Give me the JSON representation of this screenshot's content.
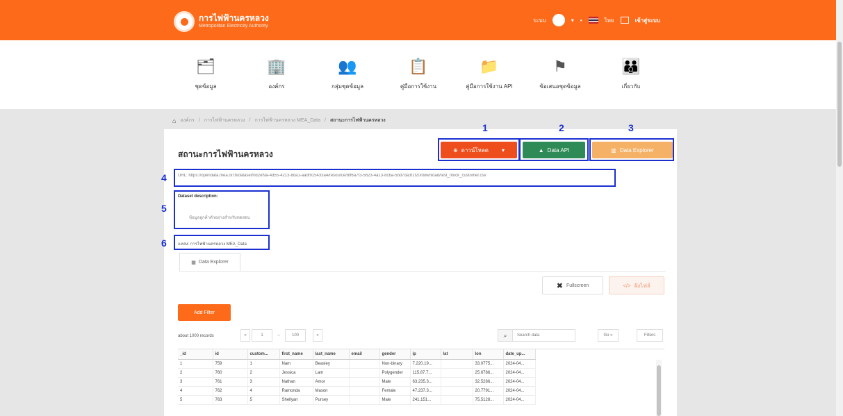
{
  "header": {
    "logo_title": "การไฟฟ้านครหลวง",
    "logo_subtitle": "Metropolitan Electricity Authority",
    "user_label": "ระบบ",
    "flag_icon": "thai-flag-icon",
    "lang_label": "ไทย",
    "login_label": "เข้าสู่ระบบ"
  },
  "nav": [
    {
      "label": "ชุดข้อมูล",
      "icon": "dataset-icon"
    },
    {
      "label": "องค์กร",
      "icon": "organization-icon"
    },
    {
      "label": "กลุ่มชุดข้อมูล",
      "icon": "group-icon"
    },
    {
      "label": "คู่มือการใช้งาน",
      "icon": "manual-icon"
    },
    {
      "label": "คู่มือการใช้งาน API",
      "icon": "api-manual-icon"
    },
    {
      "label": "ข้อเสนอชุดข้อมูล",
      "icon": "suggestion-icon"
    },
    {
      "label": "เกี่ยวกับ",
      "icon": "about-icon"
    }
  ],
  "breadcrumb": [
    "องค์กร",
    "การไฟฟ้านครหลวง",
    "การไฟฟ้านครหลวง MEA_Data",
    "สถานะการไฟฟ้านครหลวง"
  ],
  "page_title": "สถานะการไฟฟ้านครหลวง",
  "actions": {
    "download_label": "ดาวน์โหลด",
    "api_label": "Data API",
    "explorer_label": "Data Explorer"
  },
  "annotations": {
    "n1": "1",
    "n2": "2",
    "n3": "3",
    "n4": "4",
    "n5": "5",
    "n6": "6"
  },
  "resource_url": "URL: https://opendata.mea.or.th/dataset/0d2ef9a-4d55-4213-8da1-aadf915433a4/resource/bff6a7f3-5623-4a13-8cba-5bd7da3f1f20/download/test_mock_customer.csv",
  "description": {
    "title": "Dataset description:",
    "text": "ข้อมูลลูกค้าตัวอย่างสำหรับทดสอบ"
  },
  "source_label": "แหล่ง: การไฟฟ้านครหลวง MEA_Data",
  "explorer_tab": "Data Explorer",
  "fullscreen_label": "Fullscreen",
  "share_label": "ฝังไฟล์",
  "add_filter_label": "Add Filter",
  "records_label": "about 1000 records",
  "pager": {
    "prev": "«",
    "from": "1",
    "to": "100",
    "next": "»"
  },
  "search_placeholder": "Search data",
  "go_label": "Go »",
  "filters_label": "Filters",
  "table": {
    "headers": [
      "_id",
      "id",
      "custom...",
      "first_name",
      "last_name",
      "email",
      "gender",
      "ip",
      "lat",
      "lon",
      "date_up..."
    ],
    "rows": [
      [
        "1",
        "759",
        "1",
        "Nam",
        "Beasley",
        "",
        "Non-binary",
        "7.220.19...",
        "",
        "33.0775...",
        "2024-04..."
      ],
      [
        "2",
        "760",
        "2",
        "Jessica",
        "Lam",
        "",
        "Polygender",
        "115.87.7...",
        "",
        "25.6786...",
        "2024-04..."
      ],
      [
        "3",
        "761",
        "3",
        "Nathan",
        "Amor",
        "",
        "Male",
        "63.235.3...",
        "",
        "32.5286...",
        "2024-04..."
      ],
      [
        "4",
        "762",
        "4",
        "Ramonda",
        "Mason",
        "",
        "Female",
        "47.237.3...",
        "",
        "20.7791...",
        "2024-04..."
      ],
      [
        "5",
        "763",
        "5",
        "Shellyan",
        "Pursey",
        "",
        "Male",
        "241.151...",
        "",
        "75.5128...",
        "2024-04..."
      ]
    ]
  },
  "colors": {
    "brand_orange": "#fd6b1a",
    "download_red": "#ee4e1b",
    "api_green": "#2e8b57",
    "explorer_amber": "#f5b266",
    "annotation_blue": "#1a2fd1"
  }
}
